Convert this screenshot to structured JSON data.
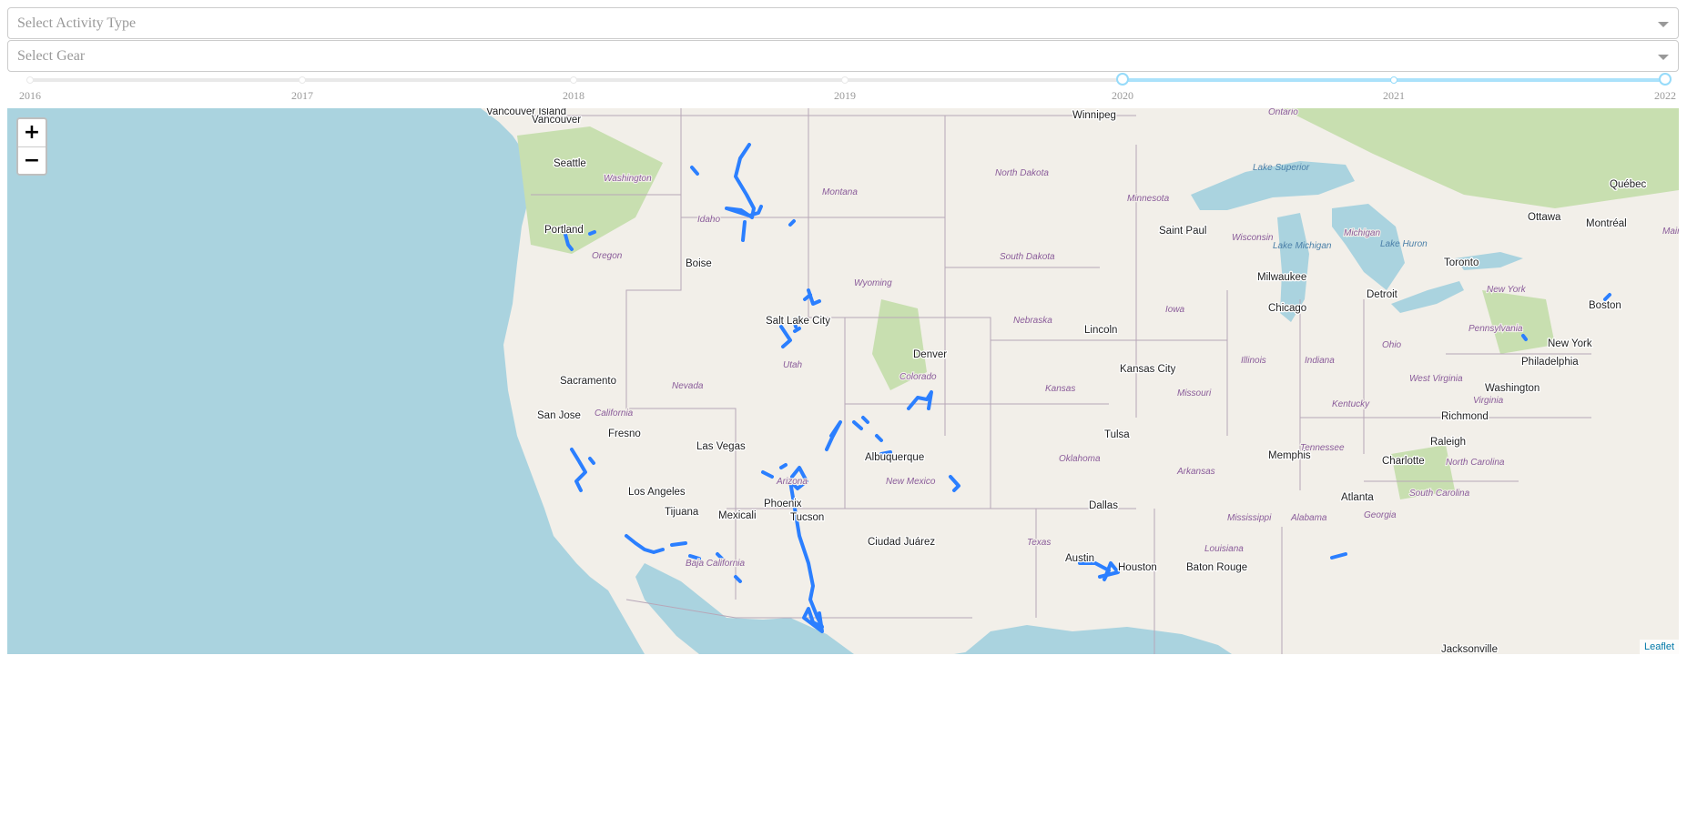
{
  "filters": {
    "activity_type": {
      "placeholder": "Select Activity Type",
      "value": ""
    },
    "gear": {
      "placeholder": "Select Gear",
      "value": ""
    }
  },
  "year_slider": {
    "marks": [
      "2016",
      "2017",
      "2018",
      "2019",
      "2020",
      "2021",
      "2022"
    ],
    "selected_range": [
      "2020",
      "2022"
    ]
  },
  "map": {
    "zoom_in_label": "+",
    "zoom_out_label": "−",
    "attribution": "Leaflet",
    "cities": [
      "Vancouver Island",
      "Vancouver",
      "Winnipeg",
      "Seattle",
      "Portland",
      "Boise",
      "Salt Lake City",
      "Denver",
      "Sacramento",
      "San Jose",
      "Fresno",
      "Las Vegas",
      "Los Angeles",
      "Tijuana",
      "Mexicali",
      "Phoenix",
      "Tucson",
      "Albuquerque",
      "Ciudad Juárez",
      "Lincoln",
      "Kansas City",
      "Tulsa",
      "Dallas",
      "Austin",
      "Houston",
      "Baton Rouge",
      "Memphis",
      "Atlanta",
      "Charlotte",
      "Raleigh",
      "Richmond",
      "Washington",
      "Philadelphia",
      "New York",
      "Boston",
      "Chicago",
      "Milwaukee",
      "Detroit",
      "Toronto",
      "Ottawa",
      "Montréal",
      "Québec",
      "Saint Paul",
      "Jacksonville"
    ],
    "regions": [
      "Washington",
      "Oregon",
      "Idaho",
      "Montana",
      "Wyoming",
      "Nevada",
      "California",
      "Utah",
      "Colorado",
      "Arizona",
      "New Mexico",
      "Baja California",
      "North Dakota",
      "South Dakota",
      "Nebraska",
      "Kansas",
      "Oklahoma",
      "Texas",
      "Minnesota",
      "Iowa",
      "Missouri",
      "Arkansas",
      "Louisiana",
      "Mississippi",
      "Alabama",
      "Georgia",
      "Tennessee",
      "Kentucky",
      "Wisconsin",
      "Illinois",
      "Indiana",
      "Ohio",
      "Michigan",
      "West Virginia",
      "Virginia",
      "North Carolina",
      "South Carolina",
      "Pennsylvania",
      "New York",
      "Ontario",
      "Maine"
    ],
    "water_labels": [
      "Lake Superior",
      "Lake Michigan",
      "Lake Huron"
    ],
    "colors": {
      "water": "#aad3df",
      "land": "#f2efe9",
      "forest": "#c8dfb0",
      "state_border": "#b7a7b8",
      "track": "#2b7fff"
    }
  }
}
